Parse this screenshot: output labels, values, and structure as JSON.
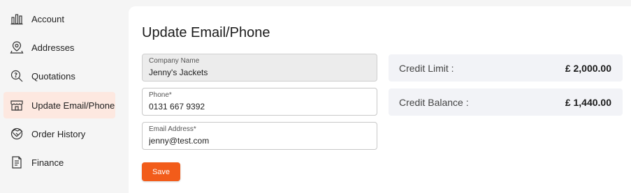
{
  "sidebar": {
    "items": [
      {
        "label": "Account",
        "icon": "company-icon",
        "active": false
      },
      {
        "label": "Addresses",
        "icon": "location-pin-icon",
        "active": false
      },
      {
        "label": "Quotations",
        "icon": "search-document-icon",
        "active": false
      },
      {
        "label": "Update Email/Phone",
        "icon": "storefront-icon",
        "active": true
      },
      {
        "label": "Order History",
        "icon": "handshake-icon",
        "active": false
      },
      {
        "label": "Finance",
        "icon": "document-icon",
        "active": false
      }
    ]
  },
  "main": {
    "title": "Update Email/Phone",
    "fields": {
      "company": {
        "label": "Company Name",
        "value": "Jenny's Jackets"
      },
      "phone": {
        "label": "Phone*",
        "value": "0131 667 9392"
      },
      "email": {
        "label": "Email Address*",
        "value": "jenny@test.com"
      }
    },
    "save_label": "Save",
    "credit_limit": {
      "label": "Credit Limit :",
      "value": "£ 2,000.00"
    },
    "credit_balance": {
      "label": "Credit Balance :",
      "value": "£ 1,440.00"
    }
  },
  "colors": {
    "accent": "#f25c1a",
    "active_nav_bg": "#fde8e0",
    "card_bg": "#f2f3f7"
  }
}
